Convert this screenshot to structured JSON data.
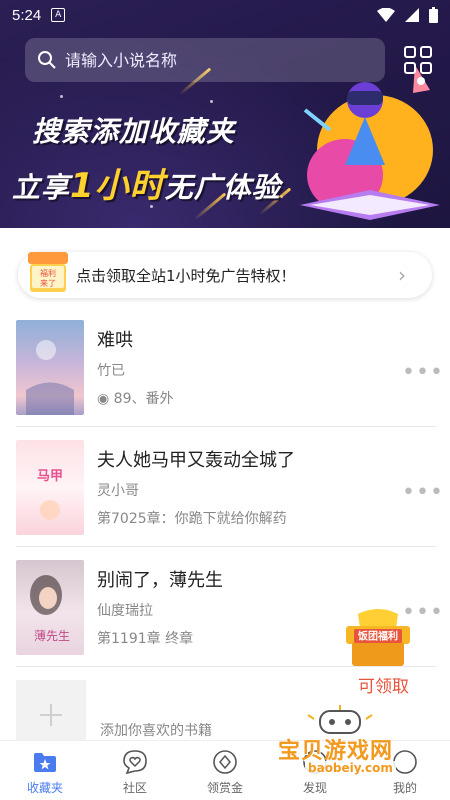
{
  "status_bar": {
    "time": "5:24",
    "indicator": "A"
  },
  "banner": {
    "search_placeholder": "请输入小说名称",
    "line1": "搜索添加收藏夹",
    "line2_prefix": "立享",
    "line2_highlight": "1小时",
    "line2_suffix": "无广体验"
  },
  "promo": {
    "gift_line1": "福利",
    "gift_line2": "来了",
    "text": "点击领取全站1小时免广告特权！",
    "chevron": "›"
  },
  "books": [
    {
      "title": "难哄",
      "author": "竹已",
      "meta": "◉ 89、番外",
      "more": "•••"
    },
    {
      "title": "夫人她马甲又轰动全城了",
      "author": "灵小哥",
      "meta": "第7025章：你跪下就给你解药",
      "more": "•••"
    },
    {
      "title": "别闹了，薄先生",
      "author": "仙度瑞拉",
      "meta": "第1191章 终章",
      "more": "•••"
    }
  ],
  "add_book": {
    "text": "添加你喜欢的书籍"
  },
  "floating_gift": {
    "badge": "饭团福利",
    "label": "可领取"
  },
  "tabs": [
    {
      "label": "收藏夹",
      "icon": "folder-star-icon",
      "active": true
    },
    {
      "label": "社区",
      "icon": "heart-chat-icon",
      "active": false
    },
    {
      "label": "领赏金",
      "icon": "coin-icon",
      "active": false
    },
    {
      "label": "发现",
      "icon": "compass-icon",
      "active": false
    },
    {
      "label": "我的",
      "icon": "user-icon",
      "active": false
    }
  ],
  "watermark": {
    "text": "宝贝游戏网",
    "url": "baobeiy.com"
  },
  "colors": {
    "accent": "#4a7cf0",
    "banner_bg": "#24194a",
    "highlight": "#ffd12e",
    "gift_red": "#e8543c"
  }
}
